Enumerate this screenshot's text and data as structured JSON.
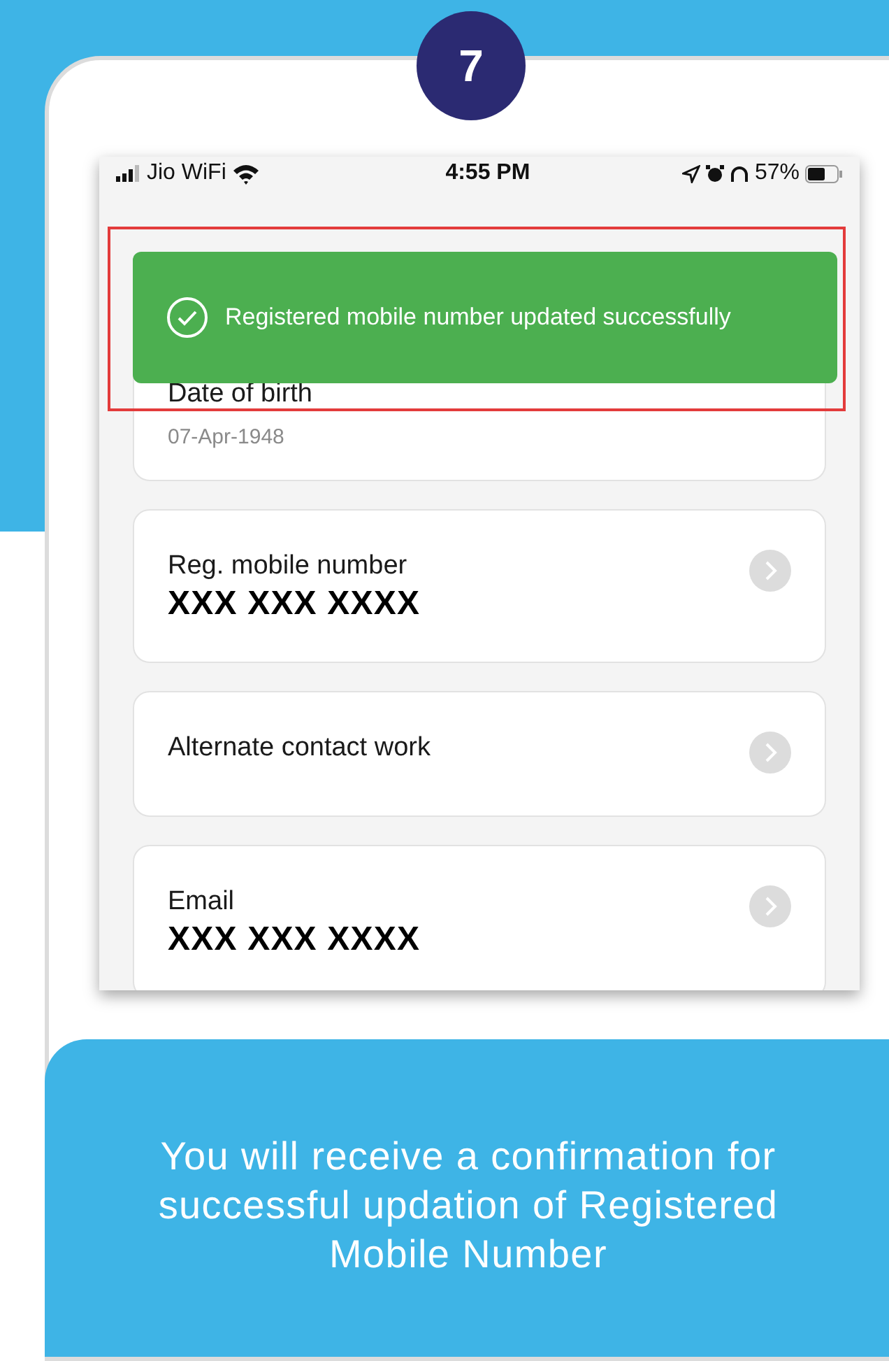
{
  "step_badge": "7",
  "status_bar": {
    "carrier": "Jio WiFi",
    "time": "4:55 PM",
    "battery": "57%"
  },
  "toast": {
    "message": "Registered mobile number updated successfully",
    "highlighted": true
  },
  "fields": [
    {
      "label": "Date of birth",
      "value": "07-Apr-1948",
      "kind": "plain",
      "chevron": false
    },
    {
      "label": "Reg. mobile number",
      "value": "XXX XXX XXXX",
      "kind": "masked",
      "chevron": true
    },
    {
      "label": "Alternate contact work",
      "kind": "label_only",
      "chevron": true
    },
    {
      "label": "Email",
      "value": "XXX XXX XXXX",
      "kind": "masked",
      "chevron": true
    }
  ],
  "caption": "You will receive a confirmation for successful updation of Registered Mobile Number"
}
